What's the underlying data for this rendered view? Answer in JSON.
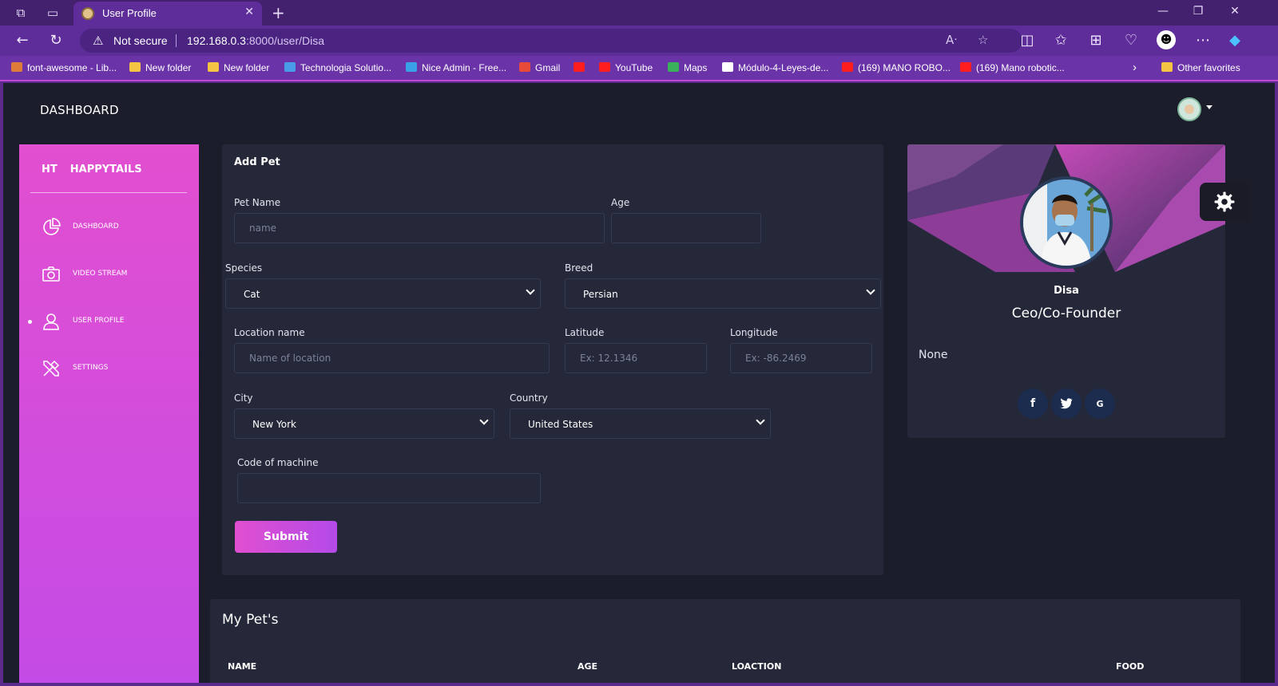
{
  "browser": {
    "tab_title": "User Profile",
    "not_secure": "Not secure",
    "url_host": "192.168.0.3",
    "url_rest": ":8000/user/Disa",
    "bookmarks": [
      {
        "label": "font-awesome - Lib...",
        "color": "#e07c3a"
      },
      {
        "label": "New folder",
        "color": "#f4c542"
      },
      {
        "label": "New folder",
        "color": "#f4c542"
      },
      {
        "label": "Technologia Solutio...",
        "color": "#4a9be8"
      },
      {
        "label": "Nice Admin - Free...",
        "color": "#3aa0e8"
      },
      {
        "label": "Gmail",
        "color": "#e84a3a"
      },
      {
        "label": "",
        "color": "#ff1e1e"
      },
      {
        "label": "YouTube",
        "color": "#ff1e1e"
      },
      {
        "label": "Maps",
        "color": "#3ab05a"
      },
      {
        "label": "Módulo-4-Leyes-de...",
        "color": "#ffffff"
      },
      {
        "label": "(169) MANO ROBO...",
        "color": "#ff1e1e"
      },
      {
        "label": "(169) Mano robotic...",
        "color": "#ff1e1e"
      }
    ],
    "other_favorites": "Other favorites"
  },
  "header": {
    "title": "DASHBOARD"
  },
  "sidebar": {
    "brand_short": "HT",
    "brand_name": "HAPPYTAILS",
    "items": [
      {
        "label": "DASHBOARD",
        "icon": "pie-chart-icon"
      },
      {
        "label": "VIDEO STREAM",
        "icon": "camera-icon"
      },
      {
        "label": "USER PROFILE",
        "icon": "user-icon",
        "active": true
      },
      {
        "label": "SETTINGS",
        "icon": "tools-icon"
      }
    ]
  },
  "form": {
    "title": "Add Pet",
    "pet_name_label": "Pet Name",
    "pet_name_placeholder": "name",
    "age_label": "Age",
    "age_value": "",
    "species_label": "Species",
    "species_value": "Cat",
    "breed_label": "Breed",
    "breed_value": "Persian",
    "location_label": "Location name",
    "location_placeholder": "Name of location",
    "latitude_label": "Latitude",
    "latitude_placeholder": "Ex: 12.1346",
    "longitude_label": "Longitude",
    "longitude_placeholder": "Ex: -86.2469",
    "city_label": "City",
    "city_value": "New York",
    "country_label": "Country",
    "country_value": "United States",
    "machine_label": "Code of machine",
    "machine_value": "",
    "submit_label": "Submit"
  },
  "profile": {
    "name": "Disa",
    "role": "Ceo/Co-Founder",
    "description": "None",
    "social": [
      "facebook-icon",
      "twitter-icon",
      "google-icon"
    ]
  },
  "pets": {
    "title": "My Pet's",
    "columns": [
      "NAME",
      "AGE",
      "LOACTION",
      "FOOD"
    ]
  },
  "colors": {
    "accent": "#d94ed8",
    "page_bg": "#1b1d2a",
    "card_bg": "#252839",
    "browser_frame": "#5e2d9a"
  }
}
